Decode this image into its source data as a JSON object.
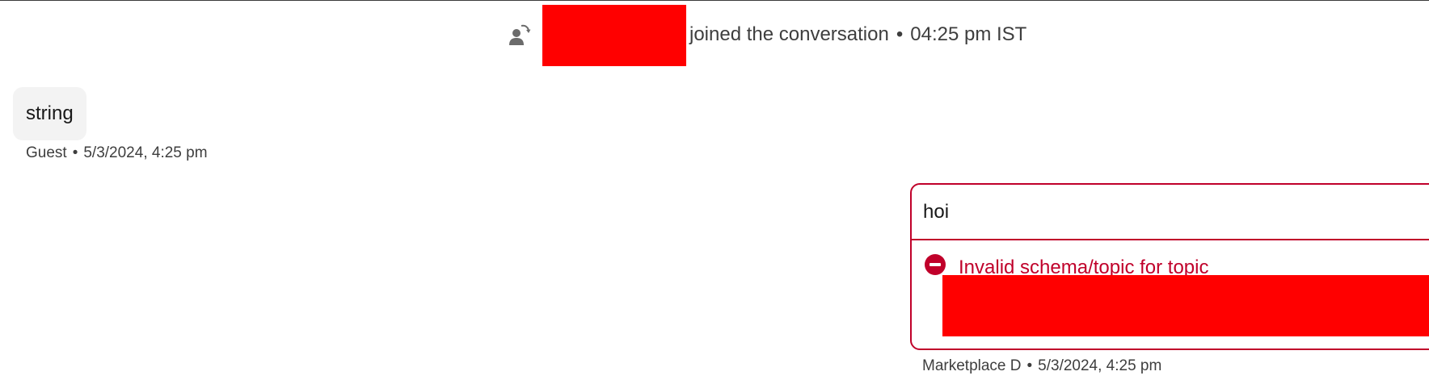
{
  "join_event": {
    "icon": "agent-transfer-icon",
    "name_redacted": true,
    "text": "joined the conversation",
    "separator": "•",
    "time": "04:25 pm IST"
  },
  "messages": [
    {
      "direction": "incoming",
      "text": "string",
      "sender": "Guest",
      "separator": "•",
      "timestamp": "5/3/2024, 4:25 pm"
    },
    {
      "direction": "outgoing",
      "text": "hoi",
      "error": {
        "icon": "error-minus-circle-icon",
        "text": "Invalid schema/topic for topic",
        "detail_redacted": true
      },
      "sender": "Marketplace D",
      "separator": "•",
      "timestamp": "5/3/2024, 4:25 pm"
    }
  ],
  "colors": {
    "error": "#c0002a",
    "redaction": "#ff0000",
    "bubble_incoming_bg": "#f3f3f3",
    "meta_text": "#3e3e3e"
  }
}
